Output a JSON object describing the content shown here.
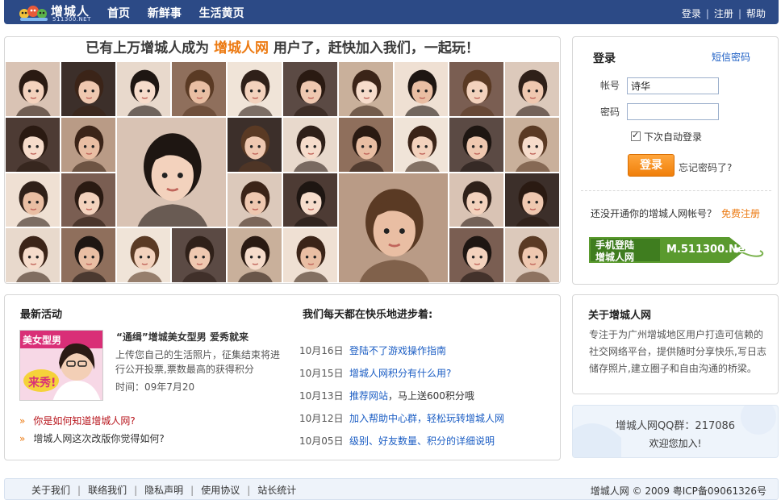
{
  "header": {
    "logo_name": "增城人",
    "logo_site": "511300.NET",
    "nav": [
      "首页",
      "新鲜事",
      "生活黄页"
    ],
    "links": {
      "login": "登录",
      "register": "注册",
      "help": "帮助"
    },
    "separator": "|"
  },
  "banner": {
    "prefix": "已有上万增城人成为",
    "highlight": "增城人网",
    "suffix": "用户了，赶快加入我们，一起玩！"
  },
  "login": {
    "title": "登录",
    "sms_link": "短信密码",
    "account_label": "帐号",
    "account_value": "诗华",
    "password_label": "密码",
    "password_value": "",
    "remember_label": "下次自动登录",
    "remember_checked": true,
    "submit_label": "登录",
    "forgot_label": "忘记密码了?",
    "no_account_text": "还没开通你的增城人网帐号？",
    "register_link": "免费注册",
    "mobile_line1": "手机登陆",
    "mobile_line2": "增城人网",
    "mobile_url": "M.511300.Net"
  },
  "activities": {
    "title": "最新活动",
    "promo": {
      "image_text_top": "美女型男",
      "image_text_bottom": "来秀!",
      "title": "“通缉”增城美女型男 爱秀就来",
      "text": "上传您自己的生活照片，征集结束将进行公开投票,票数最高的获得积分",
      "time": "时间：09年7月20"
    },
    "bullets": [
      {
        "text": "你是如何知道增城人网?",
        "highlight": true
      },
      {
        "text": "增城人网这次改版你觉得如何?",
        "highlight": false
      }
    ],
    "bullet_marker": "»"
  },
  "news": {
    "title": "我们每天都在快乐地进步着:",
    "items": [
      {
        "date": "10月16日",
        "link": "登陆不了游戏操作指南",
        "rest": ""
      },
      {
        "date": "10月15日",
        "link": "增城人网积分有什么用?",
        "rest": ""
      },
      {
        "date": "10月13日",
        "link": "推荐网站",
        "rest": "，马上送600积分哦"
      },
      {
        "date": "10月12日",
        "link": "加入帮助中心群，轻松玩转增城人网",
        "rest": ""
      },
      {
        "date": "10月05日",
        "link": "级别、好友数量、积分的详细说明",
        "rest": ""
      }
    ]
  },
  "about": {
    "title": "关于增城人网",
    "text": "专注于为广州增城地区用户打造可信赖的社交网络平台，提供随时分享快乐,写日志储存照片,建立圈子和自由沟通的桥梁。"
  },
  "qq": {
    "line": "增城人网QQ群：217086",
    "welcome": "欢迎您加入!"
  },
  "footer": {
    "links": [
      "关于我们",
      "联络我们",
      "隐私声明",
      "使用协议",
      "站长统计"
    ],
    "separator": "|",
    "copyright": "增城人网 © 2009 粤ICP备09061326号"
  },
  "colors": {
    "header_bg": "#2c4a86",
    "accent_orange": "#ec7a12",
    "link_blue": "#1c5ec4",
    "alert_red": "#b8161d",
    "mobile_green": "#5a9a2e"
  }
}
